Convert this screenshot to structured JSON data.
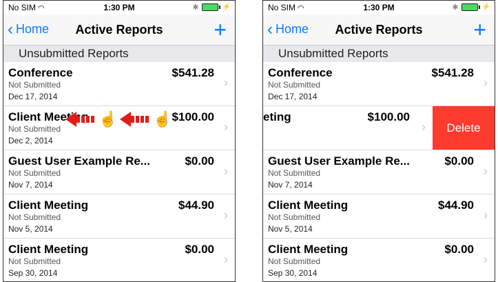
{
  "status_bar": {
    "carrier": "No SIM",
    "time": "1:30 PM"
  },
  "nav": {
    "back_label": "Home",
    "title": "Active Reports",
    "add_label": "+"
  },
  "section_header": "Unsubmitted Reports",
  "reports": [
    {
      "title": "Conference",
      "status": "Not Submitted",
      "date": "Dec 17, 2014",
      "amount": "$541.28"
    },
    {
      "title": "Client Meeting",
      "status": "Not Submitted",
      "date": "Dec 2, 2014",
      "amount": "$100.00"
    },
    {
      "title": "Guest User Example Re...",
      "status": "Not Submitted",
      "date": "Nov 7, 2014",
      "amount": "$0.00"
    },
    {
      "title": "Client Meeting",
      "status": "Not Submitted",
      "date": "Nov 5, 2014",
      "amount": "$44.90"
    },
    {
      "title": "Client Meeting",
      "status": "Not Submitted",
      "date": "Sep 30, 2014",
      "amount": "$0.00"
    }
  ],
  "right_panel": {
    "swiped_title_fragment": "eting",
    "delete_label": "Delete"
  },
  "icons": {
    "wifi": "wifi-icon",
    "bluetooth": "bluetooth-icon",
    "battery": "battery-icon",
    "chevron": "chevron-right-icon",
    "hand": "pointing-hand-icon",
    "arrow": "swipe-left-arrow-icon"
  },
  "colors": {
    "accent": "#0a7aff",
    "delete": "#ff3b30",
    "arrow": "#e41b1b"
  }
}
